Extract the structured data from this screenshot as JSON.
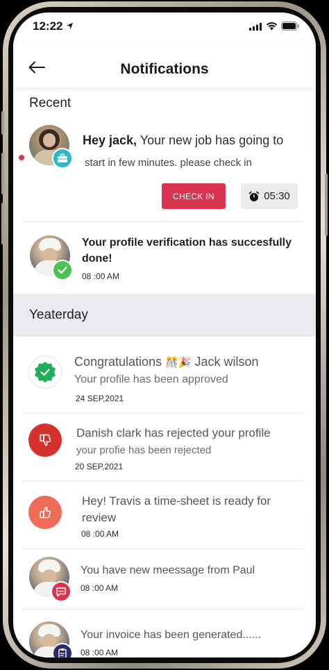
{
  "status_bar": {
    "time": "12:22"
  },
  "header": {
    "title": "Notifications"
  },
  "sections": {
    "recent": "Recent",
    "yesterday": "Yeaterday"
  },
  "recent": {
    "job": {
      "greeting": "Hey jack,",
      "message_line1": " Your new job has going to",
      "message_line2": "start in few minutes. please check in",
      "checkin_label": "CHECK IN",
      "timer": "05:30"
    },
    "verification": {
      "message_line1": "Your profile verification has succesfully",
      "message_line2": "done!",
      "time": "08 :00 AM"
    }
  },
  "yesterday": {
    "approved": {
      "title_pre": "Congratulations",
      "emojis": "🎊🎉",
      "title_post": "Jack wilson",
      "subtitle": "Your profile has been approved",
      "date": "24 SEP,2021"
    },
    "rejected": {
      "title": "Danish clark has rejected your profile",
      "subtitle": "your profie has been rejected",
      "date": "20 SEP,2021"
    },
    "timesheet": {
      "line1": "Hey! Travis a time-sheet is ready for",
      "line2": "review",
      "time": "08 :00 AM"
    },
    "message": {
      "title": "You have new meessage from Paul",
      "time": "08 :00 AM"
    },
    "invoice": {
      "title": "Your invoice has been generated......",
      "time": "08 :00 AM"
    }
  },
  "colors": {
    "accent_red": "#d8344f",
    "approved_green": "#1fae5b",
    "rejected_red": "#d6322d",
    "like_orange": "#ef6b56",
    "section_band": "#eaebef"
  }
}
